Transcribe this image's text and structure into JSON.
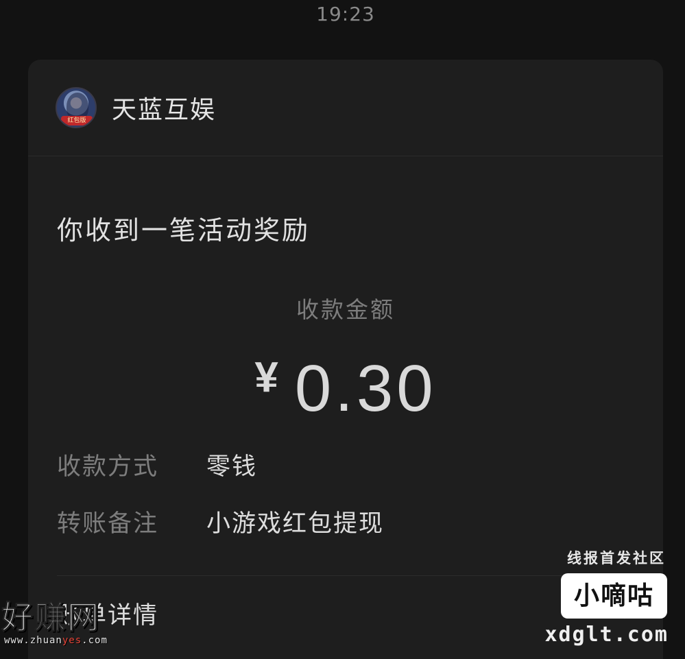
{
  "status_bar": {
    "time": "19:23"
  },
  "card": {
    "app_name": "天蓝互娱",
    "avatar_badge": "红包版",
    "message_title": "你收到一笔活动奖励",
    "amount_label": "收款金额",
    "currency_symbol": "¥",
    "amount": "0.30",
    "details": [
      {
        "label": "收款方式",
        "value": "零钱"
      },
      {
        "label": "转账备注",
        "value": "小游戏红包提现"
      }
    ],
    "bill_details_label": "账单详情"
  },
  "watermarks": {
    "right_tag": "线报首发社区",
    "right_box": "小嘀咕",
    "right_domain": "xdglt.com",
    "left_title": "好赚网",
    "left_url_prefix": "www.zhuan",
    "left_url_highlight": "yes",
    "left_url_suffix": ".com"
  }
}
